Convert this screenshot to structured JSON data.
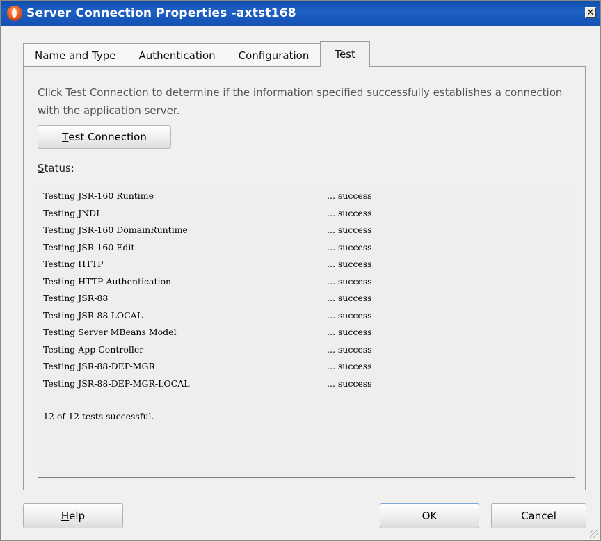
{
  "window": {
    "title": "Server Connection Properties -axtst168",
    "close_glyph": "✕"
  },
  "tabs": [
    {
      "label": "Name and Type"
    },
    {
      "label": "Authentication"
    },
    {
      "label": "Configuration"
    },
    {
      "label": "Test",
      "active": true
    }
  ],
  "test_panel": {
    "description": "Click Test Connection to determine if the information specified successfully establishes a connection with the application server.",
    "test_button": {
      "mnemonic": "T",
      "rest": "est Connection"
    },
    "status_label": {
      "mnemonic": "S",
      "rest": "tatus:"
    },
    "results": [
      {
        "name": "Testing JSR-160 Runtime",
        "result": "... success"
      },
      {
        "name": "Testing JNDI",
        "result": "... success"
      },
      {
        "name": "Testing JSR-160 DomainRuntime",
        "result": "... success"
      },
      {
        "name": "Testing JSR-160 Edit",
        "result": "... success"
      },
      {
        "name": "Testing HTTP",
        "result": "... success"
      },
      {
        "name": "Testing HTTP Authentication",
        "result": "... success"
      },
      {
        "name": "Testing JSR-88",
        "result": "... success"
      },
      {
        "name": "Testing JSR-88-LOCAL",
        "result": "... success"
      },
      {
        "name": "Testing Server MBeans Model",
        "result": "... success"
      },
      {
        "name": "Testing App Controller",
        "result": "... success"
      },
      {
        "name": "Testing JSR-88-DEP-MGR",
        "result": "... success"
      },
      {
        "name": "Testing JSR-88-DEP-MGR-LOCAL",
        "result": "... success"
      }
    ],
    "summary": "12 of 12 tests successful."
  },
  "buttons": {
    "help": {
      "mnemonic": "H",
      "rest": "elp"
    },
    "ok": "OK",
    "cancel": "Cancel"
  }
}
